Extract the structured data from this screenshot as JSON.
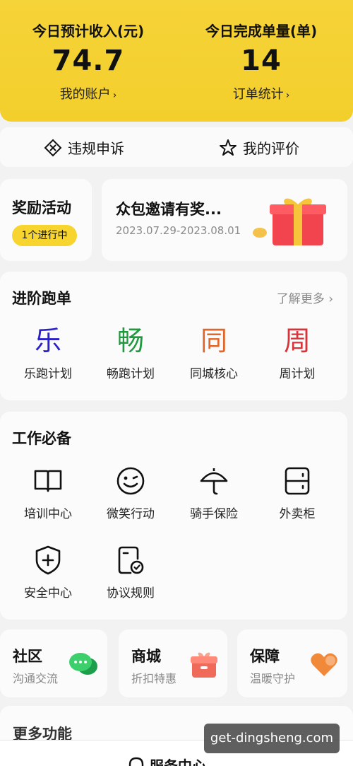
{
  "header": {
    "income_label": "今日预计收入(元)",
    "income_value": "74.7",
    "account_link": "我的账户",
    "orders_label": "今日完成单量(单)",
    "orders_value": "14",
    "orders_link": "订单统计",
    "chevron": "›"
  },
  "quick_links": {
    "appeal": "违规申诉",
    "rating": "我的评价"
  },
  "reward": {
    "title": "奖励活动",
    "badge": "1个进行中",
    "promo_title": "众包邀请有奖...",
    "promo_dates": "2023.07.29-2023.08.01"
  },
  "advanced": {
    "title": "进阶跑单",
    "more": "了解更多",
    "more_chevron": "›",
    "items": [
      {
        "glyph": "乐",
        "label": "乐跑计划",
        "color": "#2a22c8"
      },
      {
        "glyph": "畅",
        "label": "畅跑计划",
        "color": "#1f9a3e"
      },
      {
        "glyph": "同",
        "label": "同城核心",
        "color": "#e0662a"
      },
      {
        "glyph": "周",
        "label": "周计划",
        "color": "#d8333b"
      }
    ]
  },
  "work": {
    "title": "工作必备",
    "items": [
      {
        "icon": "book-icon",
        "label": "培训中心"
      },
      {
        "icon": "smile-icon",
        "label": "微笑行动"
      },
      {
        "icon": "umbrella-icon",
        "label": "骑手保险"
      },
      {
        "icon": "cabinet-icon",
        "label": "外卖柜"
      },
      {
        "icon": "shield-icon",
        "label": "安全中心"
      },
      {
        "icon": "agreement-icon",
        "label": "协议规则"
      }
    ]
  },
  "cards": [
    {
      "title": "社区",
      "sub": "沟通交流",
      "icon": "chat-icon",
      "color": "#2bb55a"
    },
    {
      "title": "商城",
      "sub": "折扣特惠",
      "icon": "gift-box-icon",
      "color": "#f06a5a"
    },
    {
      "title": "保障",
      "sub": "温暖守护",
      "icon": "heart-icon",
      "color": "#f08a3a"
    }
  ],
  "more_functions": "更多功能",
  "service_center": "服务中心",
  "watermark": "get-dingsheng.com",
  "colors": {
    "brand_yellow": "#f5d232"
  }
}
